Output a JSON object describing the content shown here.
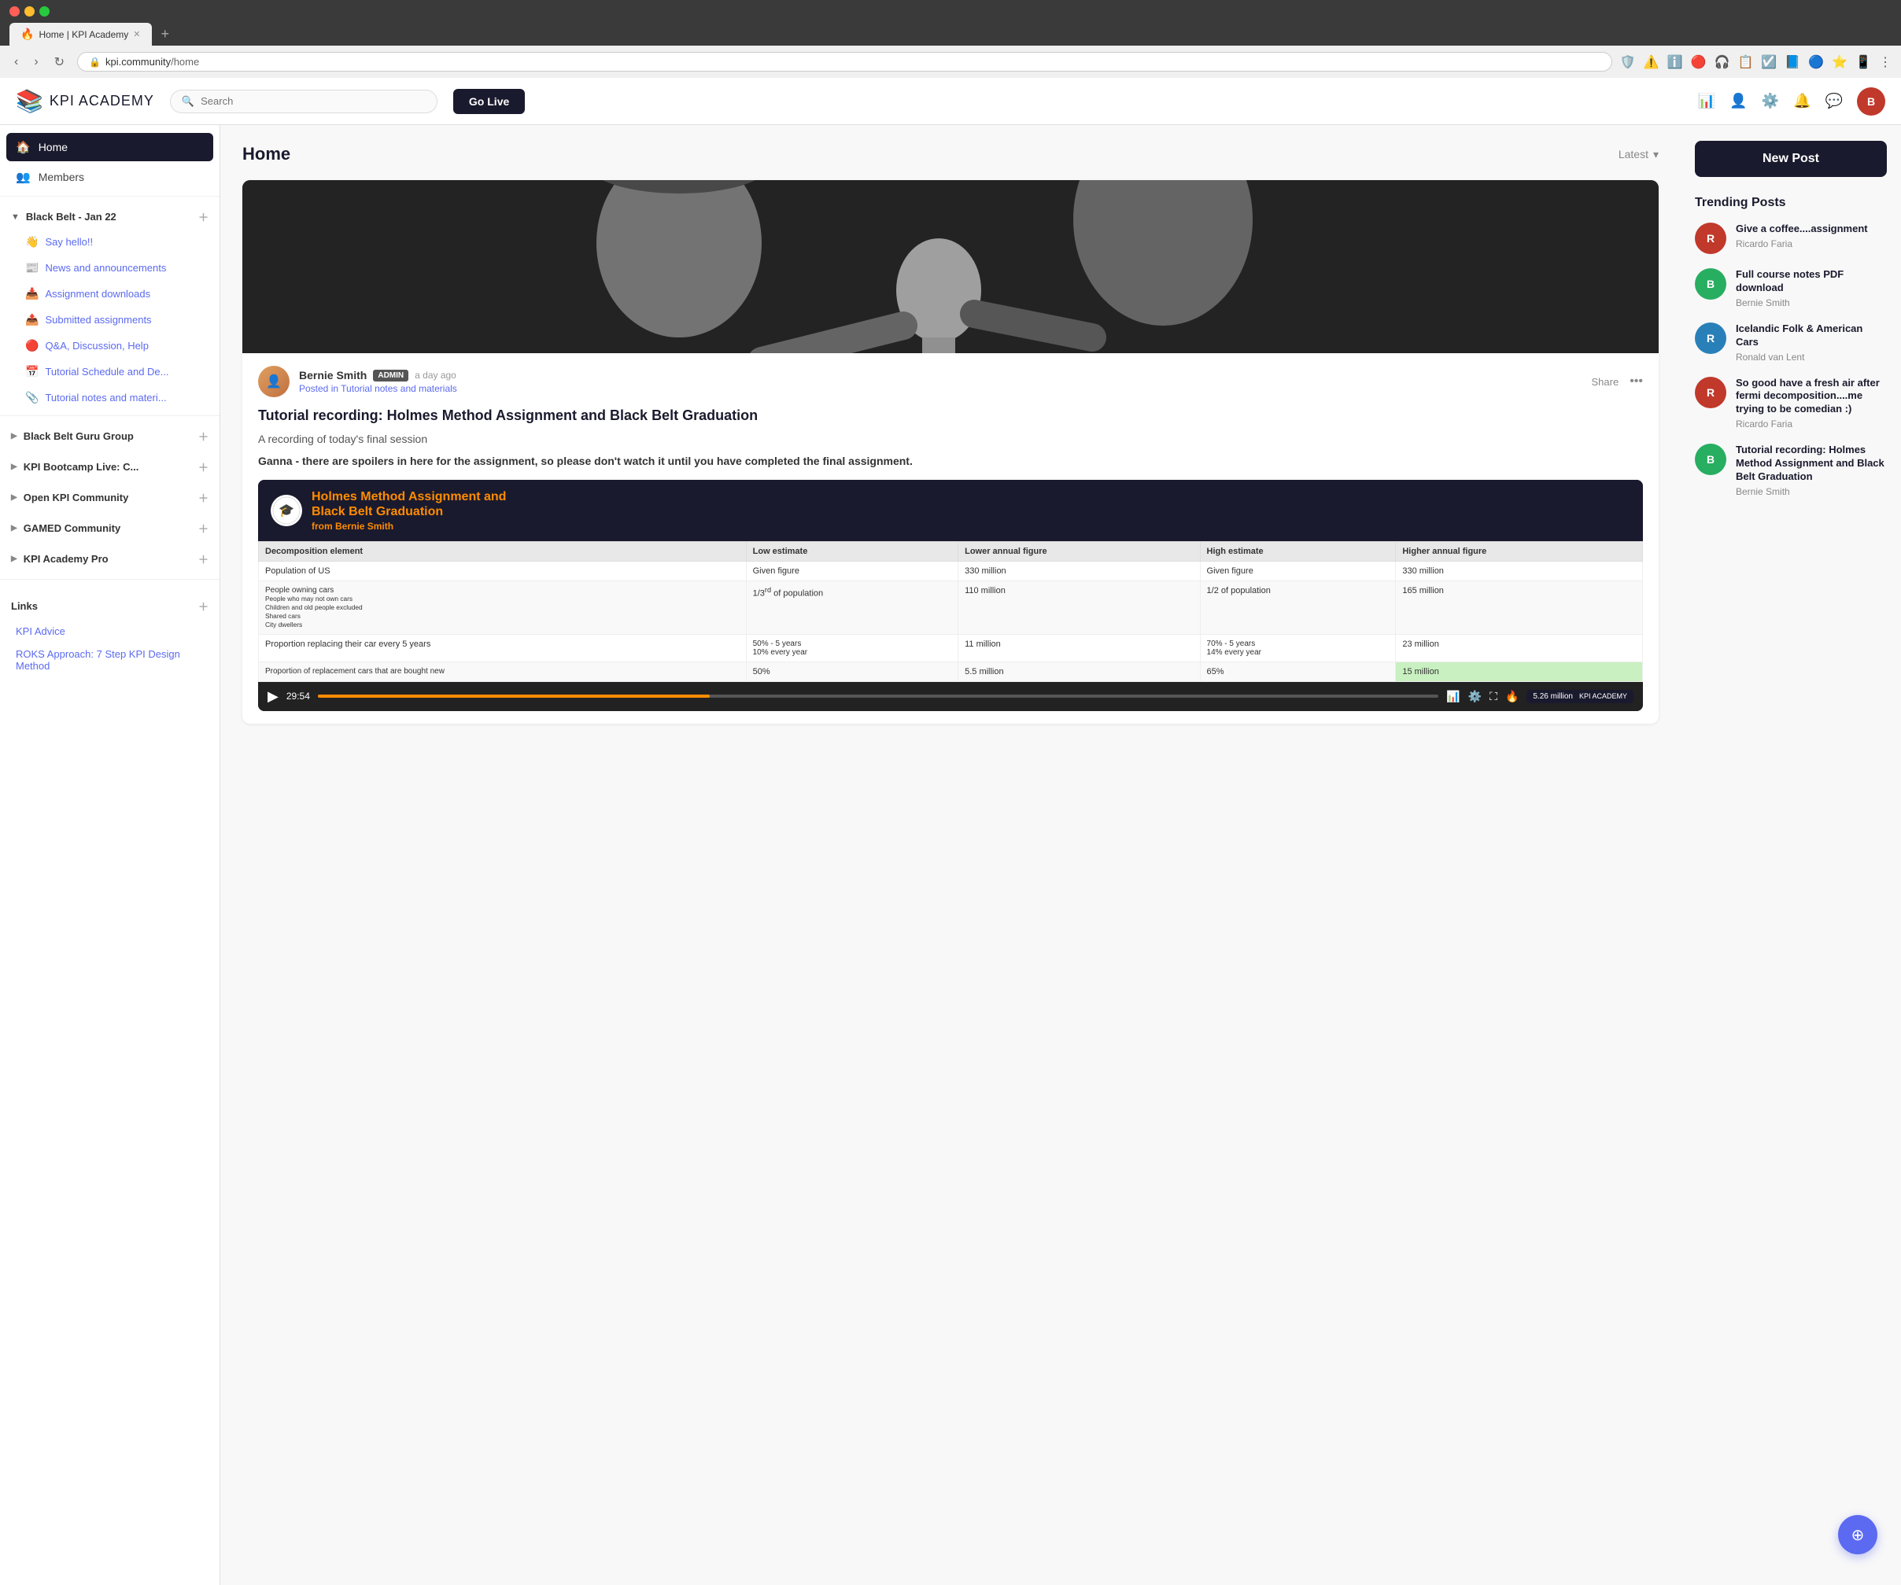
{
  "browser": {
    "tab_title": "Home | KPI Academy",
    "tab_favicon": "🔥",
    "url_domain": "kpi.community",
    "url_path": "/home",
    "new_tab_label": "+"
  },
  "header": {
    "logo_icon": "📚",
    "logo_brand": "KPI",
    "logo_sub": " ACADEMY",
    "search_placeholder": "Search",
    "go_live_label": "Go Live",
    "avatar_initials": "B"
  },
  "sidebar": {
    "home_label": "Home",
    "members_label": "Members",
    "black_belt_group": {
      "title": "Black Belt - Jan 22",
      "items": [
        {
          "icon": "👋",
          "label": "Say hello!!"
        },
        {
          "icon": "📰",
          "label": "News and announcements"
        },
        {
          "icon": "📥",
          "label": "Assignment downloads"
        },
        {
          "icon": "📤",
          "label": "Submitted assignments"
        },
        {
          "icon": "🔴",
          "label": "Q&A, Discussion, Help"
        },
        {
          "icon": "📅",
          "label": "Tutorial Schedule and De..."
        },
        {
          "icon": "📎",
          "label": "Tutorial notes and materi..."
        }
      ]
    },
    "groups": [
      {
        "title": "Black Belt Guru Group"
      },
      {
        "title": "KPI Bootcamp Live: C..."
      },
      {
        "title": "Open KPI Community"
      },
      {
        "title": "GAMED Community"
      },
      {
        "title": "KPI Academy Pro"
      }
    ],
    "links_section": "Links",
    "links": [
      {
        "label": "KPI Advice"
      },
      {
        "label": "ROKS Approach: 7 Step KPI Design Method"
      }
    ]
  },
  "content": {
    "title": "Home",
    "sort_label": "Latest",
    "post": {
      "author_name": "Bernie Smith",
      "admin_badge": "ADMIN",
      "time_ago": "a day ago",
      "posted_in_prefix": "Posted in",
      "posted_in": "Tutorial notes and materials",
      "share_label": "Share",
      "post_title": "Tutorial recording: Holmes Method Assignment and Black Belt Graduation",
      "subtitle": "A recording of today's final session",
      "spoiler_warning": "Ganna - there are spoilers in here for the assignment, so please don't watch it until you have completed the final assignment.",
      "video": {
        "title_line1": "Holmes Method Assignment and",
        "title_line2": "Black Belt Graduation",
        "from_label": "from",
        "from_author": "Bernie Smith",
        "table_headers": [
          "Decomposition element",
          "Low estimate",
          "Lower annual figure",
          "High estimate",
          "Higher annual figure"
        ],
        "table_rows": [
          [
            "Population of US",
            "Given figure",
            "330 million",
            "Given figure",
            "330 million"
          ],
          [
            "People owning cars\nPeople who may not own cars\nChildren and old people excluded\nShared cars\nCity dwellers",
            "1/3rd of population",
            "110 million",
            "1/2 of population",
            "165 million"
          ],
          [
            "Proportion replacing their car every 5 years",
            "50% - 5 years\n10% every year",
            "11 million",
            "70% - 5 years\n14% every year",
            "23 million"
          ],
          [
            "Proportion of replacement cars that are bought new",
            "50%",
            "5.5 million",
            "65%",
            "15 million"
          ]
        ],
        "timestamp": "29:54",
        "badge_value": "5.26 million",
        "badge_sub": "KPI ACADEMY"
      }
    }
  },
  "trending": {
    "section_title": "Trending Posts",
    "new_post_label": "New Post",
    "posts": [
      {
        "title": "Give a coffee....assignment",
        "author": "Ricardo Faria",
        "avatar_color": "#c0392b"
      },
      {
        "title": "Full course notes PDF download",
        "author": "Bernie Smith",
        "avatar_color": "#27ae60"
      },
      {
        "title": "Icelandic Folk & American Cars",
        "author": "Ronald van Lent",
        "avatar_color": "#2980b9"
      },
      {
        "title": "So good have a fresh air after fermi decomposition....me trying to be comedian :)",
        "author": "Ricardo Faria",
        "avatar_color": "#c0392b"
      },
      {
        "title": "Tutorial recording: Holmes Method Assignment and Black Belt Graduation",
        "author": "Bernie Smith",
        "avatar_color": "#27ae60"
      }
    ]
  }
}
